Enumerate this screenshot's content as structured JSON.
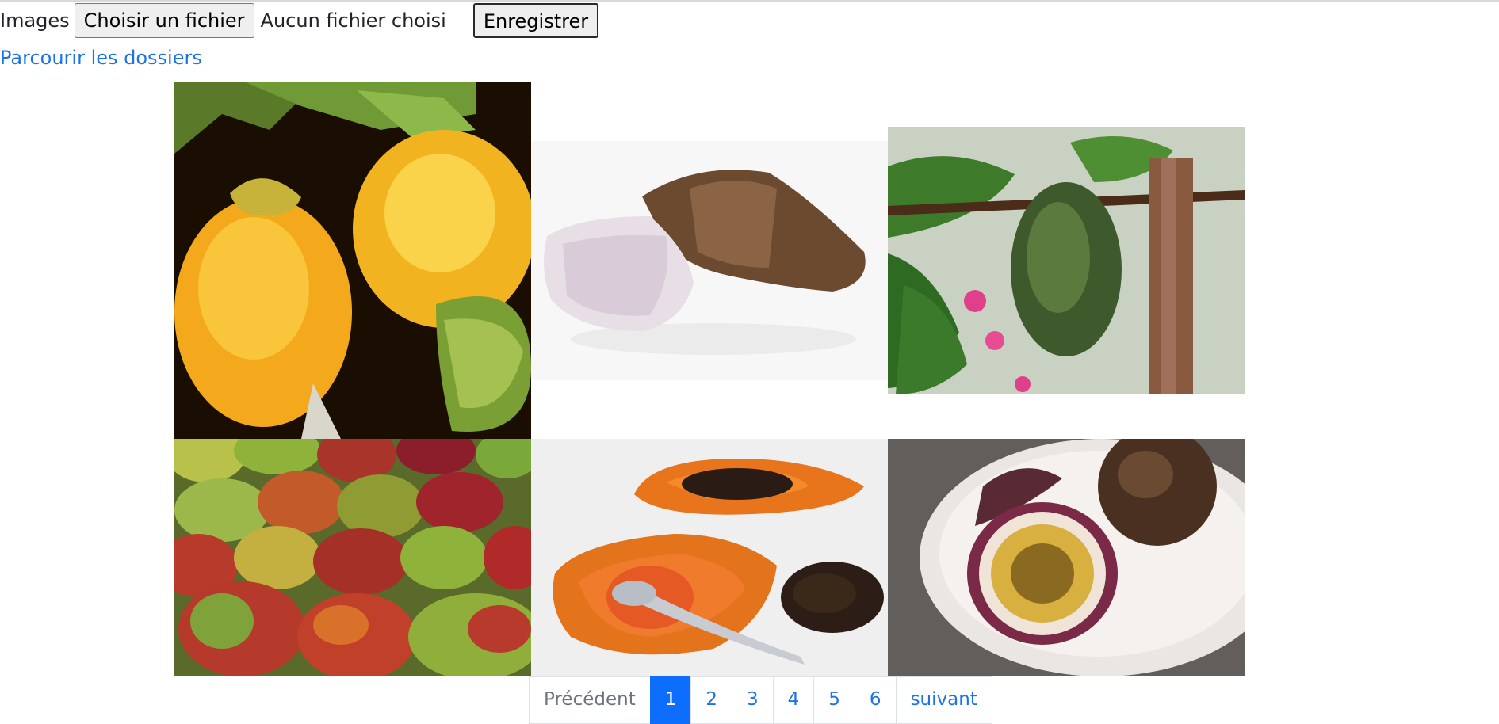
{
  "upload": {
    "label": "Images",
    "choose_button": "Choisir un fichier",
    "no_file_text": "Aucun fichier choisi",
    "save_button": "Enregistrer"
  },
  "browse_link": "Parcourir les dossiers",
  "gallery": {
    "images": [
      {
        "subject": "persimmons"
      },
      {
        "subject": "taro-root"
      },
      {
        "subject": "soursop"
      },
      {
        "subject": "mangoes"
      },
      {
        "subject": "papaya"
      },
      {
        "subject": "passion-fruit"
      }
    ]
  },
  "pagination": {
    "previous": "Précédent",
    "pages": [
      "1",
      "2",
      "3",
      "4",
      "5",
      "6"
    ],
    "current": "1",
    "next": "suivant"
  },
  "colors": {
    "link": "#1a73e8",
    "active_page": "#0d6efd"
  }
}
